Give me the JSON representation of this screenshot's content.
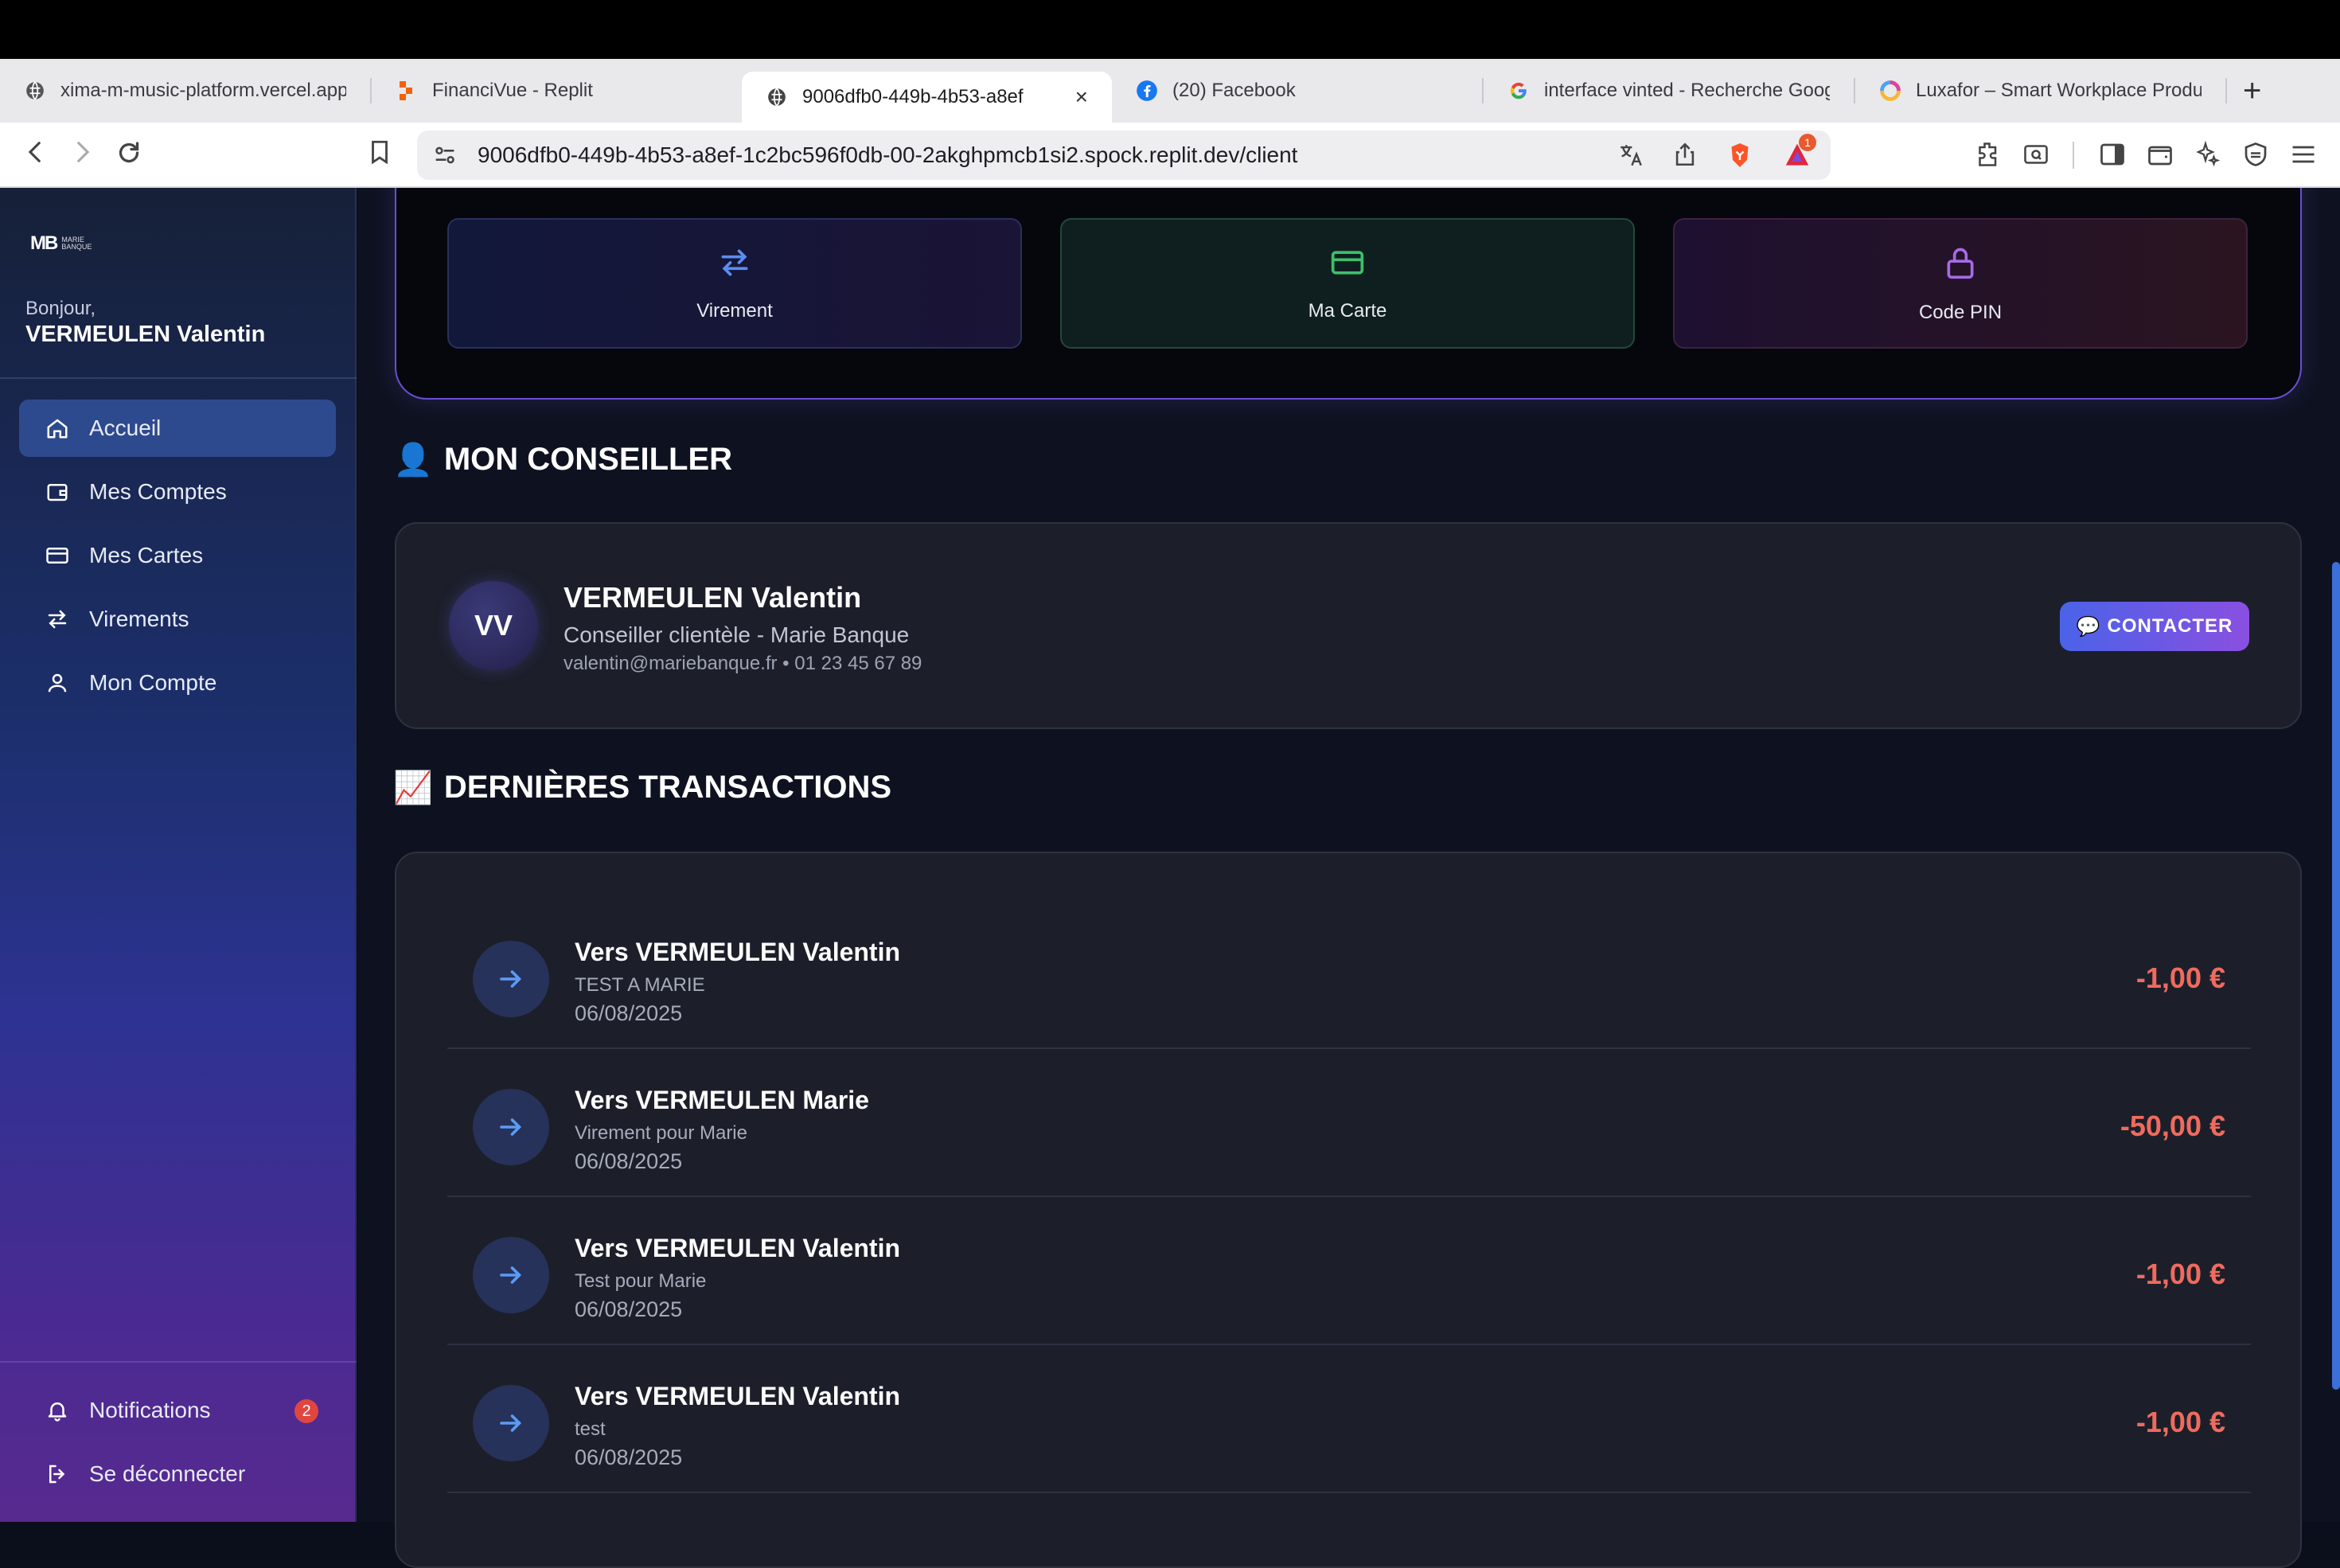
{
  "browser": {
    "tabs": [
      {
        "title": "xima-m-music-platform.vercel.app",
        "icon": "globe-icon",
        "active": false
      },
      {
        "title": "FinanciVue - Replit",
        "icon": "replit-icon",
        "active": false
      },
      {
        "title": "9006dfb0-449b-4b53-a8ef",
        "icon": "globe-icon",
        "active": true
      },
      {
        "title": "(20) Facebook",
        "icon": "facebook-icon",
        "active": false
      },
      {
        "title": "interface vinted - Recherche Google",
        "icon": "google-icon",
        "active": false
      },
      {
        "title": "Luxafor – Smart Workplace Products",
        "icon": "luxafor-icon",
        "active": false
      }
    ],
    "new_tab": "+",
    "close": "×",
    "url": "9006dfb0-449b-4b53-a8ef-1c2bc596f0db-00-2akghpmcb1si2.spock.replit.dev/client",
    "brave_badge": "1"
  },
  "sidebar": {
    "logo_mark": "MB",
    "logo_sub1": "MARIE",
    "logo_sub2": "BANQUE",
    "greeting": "Bonjour,",
    "user": "VERMEULEN Valentin",
    "items": [
      {
        "label": "Accueil",
        "icon": "home-icon",
        "active": true
      },
      {
        "label": "Mes Comptes",
        "icon": "wallet-icon",
        "active": false
      },
      {
        "label": "Mes Cartes",
        "icon": "card-icon",
        "active": false
      },
      {
        "label": "Virements",
        "icon": "transfer-icon",
        "active": false
      },
      {
        "label": "Mon Compte",
        "icon": "user-icon",
        "active": false
      }
    ],
    "notifications": {
      "label": "Notifications",
      "count": "2"
    },
    "logout": "Se déconnecter"
  },
  "quick_actions": [
    {
      "label": "Virement",
      "icon": "transfer-icon",
      "color": "#5b8def"
    },
    {
      "label": "Ma Carte",
      "icon": "card-icon",
      "color": "#3fbf6a"
    },
    {
      "label": "Code PIN",
      "icon": "lock-icon",
      "color": "#a66ae6"
    }
  ],
  "advisor": {
    "heading_emoji": "👤",
    "heading": "MON CONSEILLER",
    "initials": "VV",
    "name": "VERMEULEN Valentin",
    "role": "Conseiller clientèle - Marie Banque",
    "contact": "valentin@mariebanque.fr • 01 23 45 67 89",
    "button_emoji": "💬",
    "button": "CONTACTER"
  },
  "transactions": {
    "heading_emoji": "📈",
    "heading": "DERNIÈRES TRANSACTIONS",
    "items": [
      {
        "name": "Vers VERMEULEN Valentin",
        "desc": "TEST A MARIE",
        "date": "06/08/2025",
        "amount": "-1,00 €"
      },
      {
        "name": "Vers VERMEULEN Marie",
        "desc": "Virement pour Marie",
        "date": "06/08/2025",
        "amount": "-50,00 €"
      },
      {
        "name": "Vers VERMEULEN Valentin",
        "desc": "Test pour Marie",
        "date": "06/08/2025",
        "amount": "-1,00 €"
      },
      {
        "name": "Vers VERMEULEN Valentin",
        "desc": "test",
        "date": "06/08/2025",
        "amount": "-1,00 €"
      }
    ]
  },
  "colors": {
    "accent": "#2e4a8e",
    "negative": "#ef6b5d"
  }
}
